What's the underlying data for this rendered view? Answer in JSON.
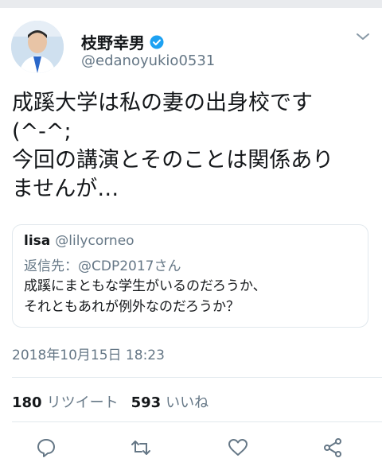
{
  "author": {
    "display_name": "枝野幸男",
    "handle": "@edanoyukio0531",
    "verified": true
  },
  "tweet": {
    "text": "成蹊大学は私の妻の出身校です\n(^-^;\n今回の講演とそのことは関係あり\nませんが…"
  },
  "quoted_tweet": {
    "name": "lisa",
    "handle": "@lilycorneo",
    "reply_to": "返信先：@CDP2017さん",
    "text": "成蹊にまともな学生がいるのだろうか、\nそれともあれが例外なのだろうか？"
  },
  "timestamp": "2018年10月15日 18:23",
  "stats": {
    "retweets_count": "180",
    "retweets_label": "リツイート",
    "likes_count": "593",
    "likes_label": "いいね"
  },
  "colors": {
    "text_primary": "#14171a",
    "text_secondary": "#657786",
    "border": "#e1e8ed",
    "verified_blue": "#1da1f2"
  },
  "icons": [
    "avatar",
    "verified-badge-icon",
    "chevron-down-icon",
    "reply-icon",
    "retweet-icon",
    "like-icon",
    "share-icon"
  ]
}
